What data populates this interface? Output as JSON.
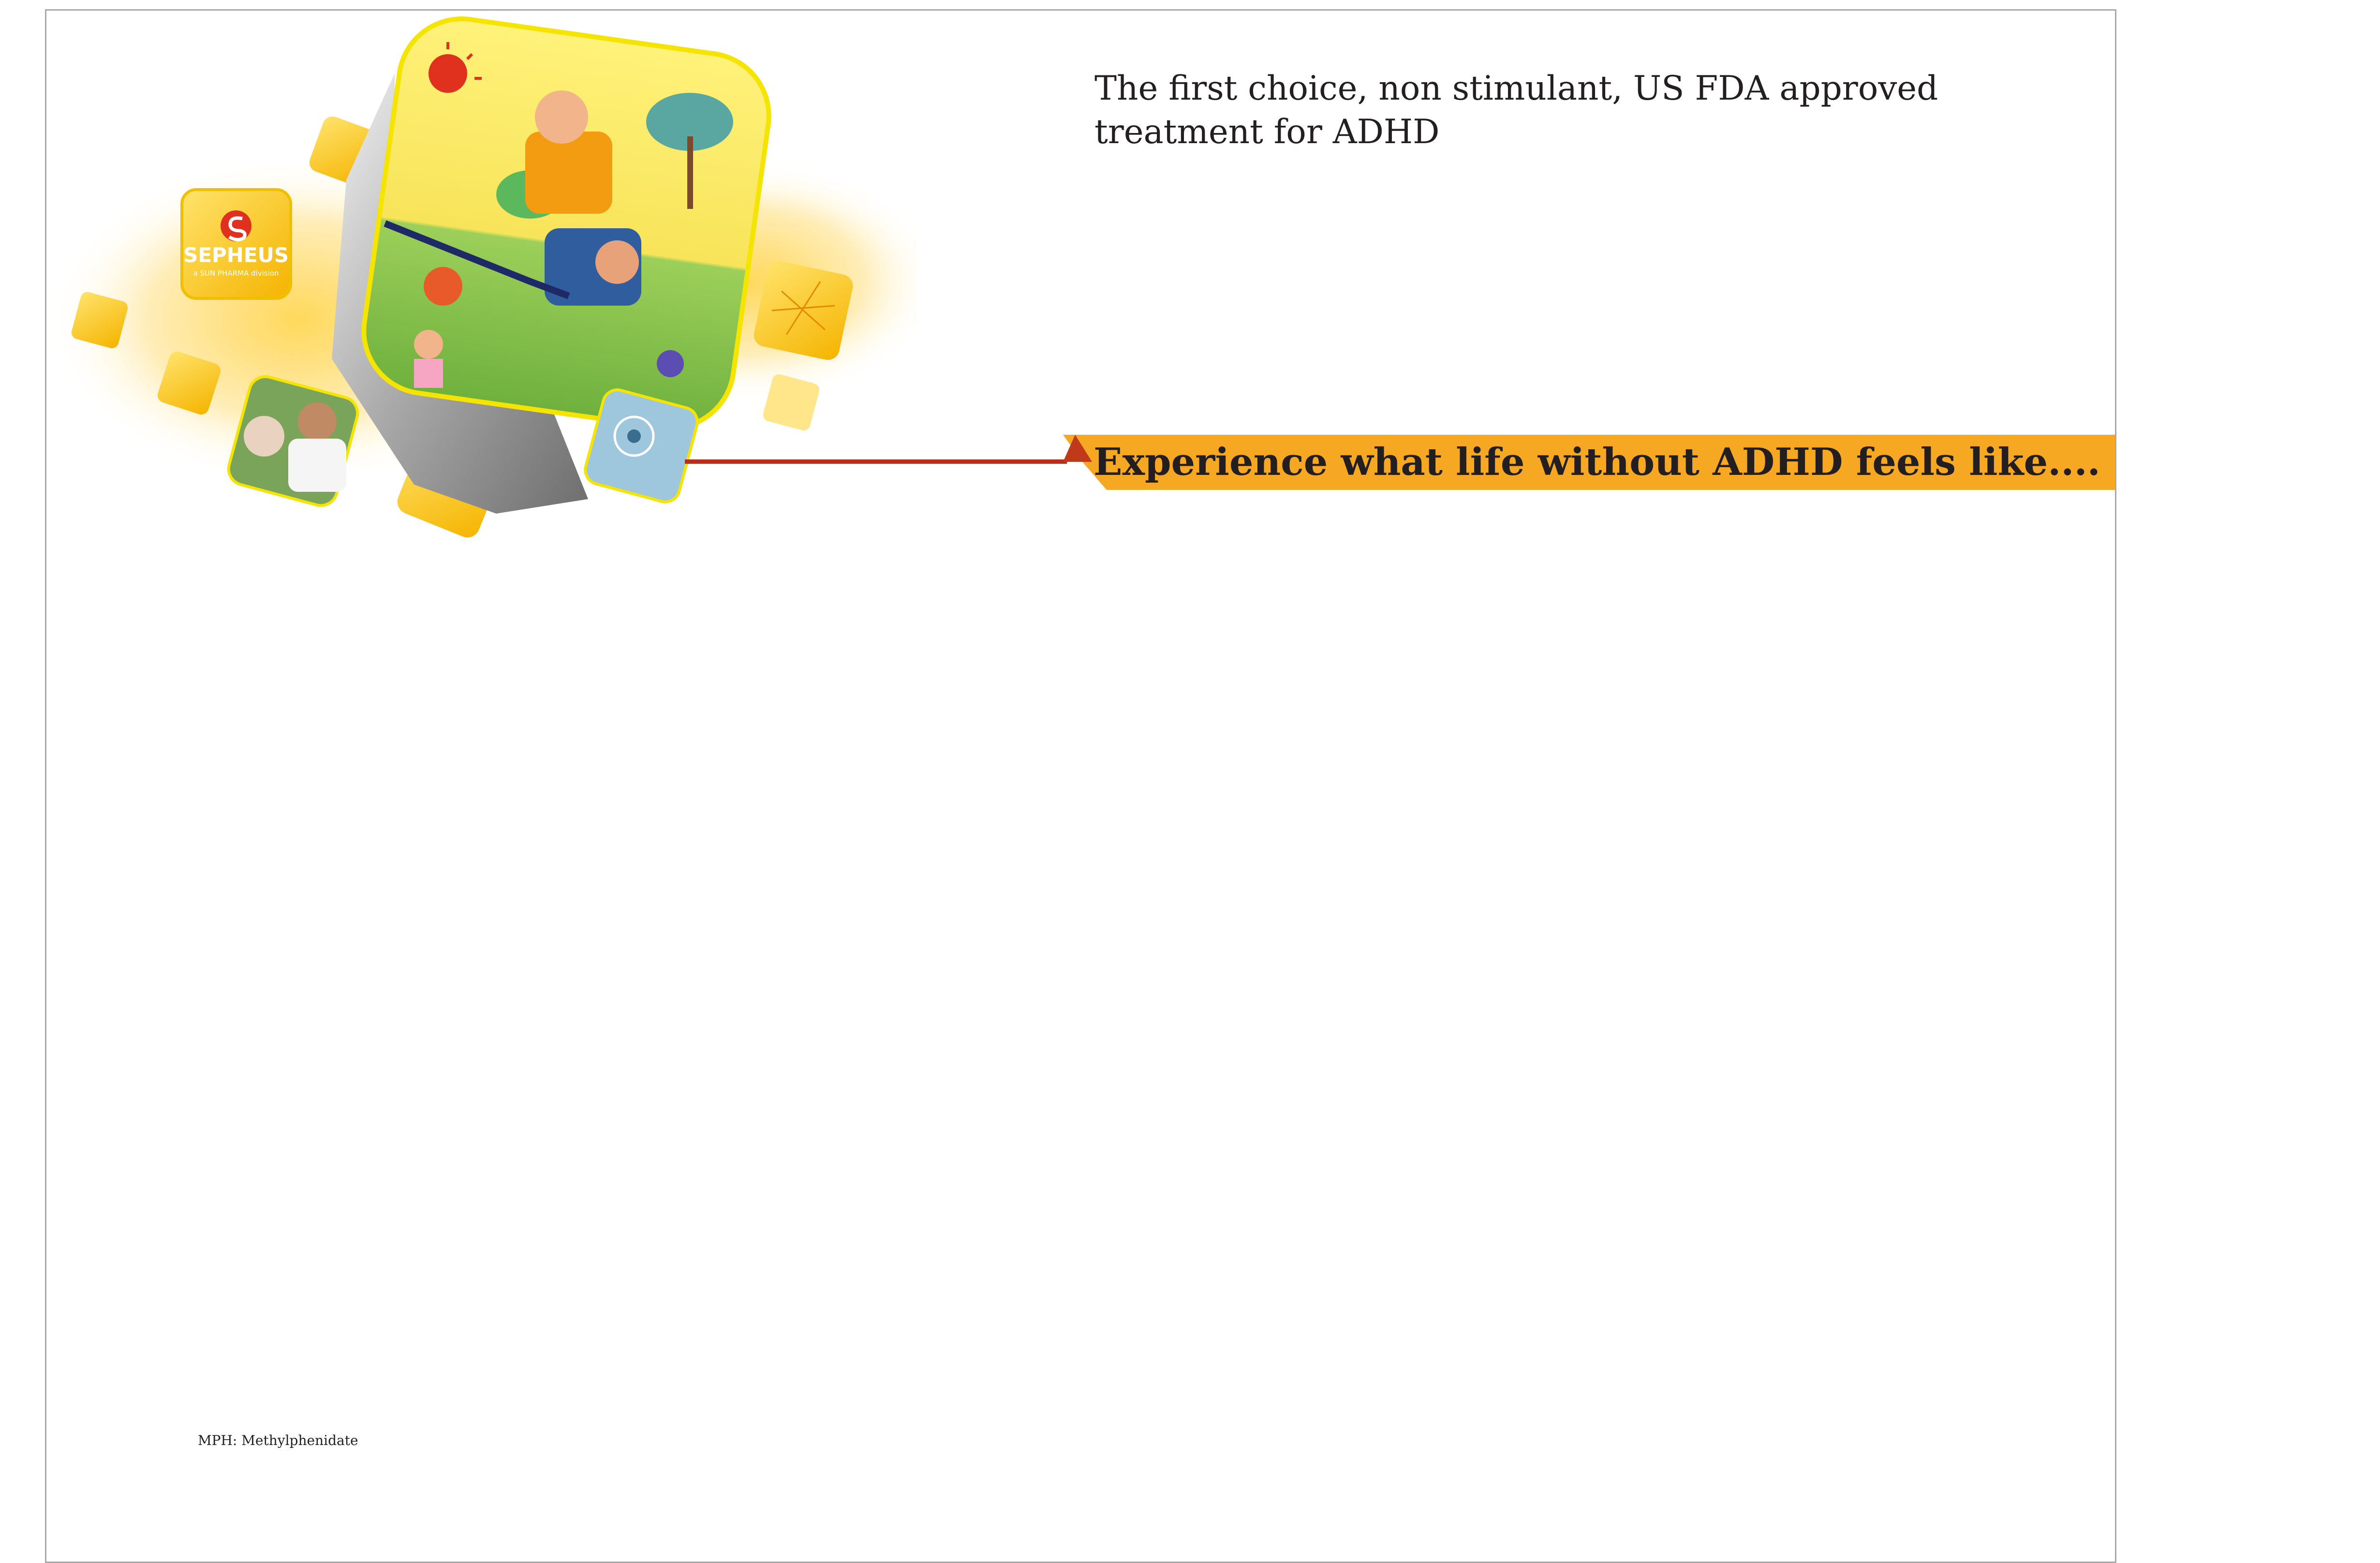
{
  "headline": "The first choice, non stimulant, US FDA approved treatment for ADHD",
  "banner": "Experience what life without ADHD feels like....",
  "footnote": "MPH: Methylphenidate",
  "logo": {
    "name": "SEPHEUS",
    "tagline": "a SUN PHARMA division"
  },
  "colors": {
    "ribbon": "#f7a823",
    "ribbon_fold": "#c0391b",
    "connector": "#b5301a",
    "tile_yellow": "#fcd116"
  }
}
